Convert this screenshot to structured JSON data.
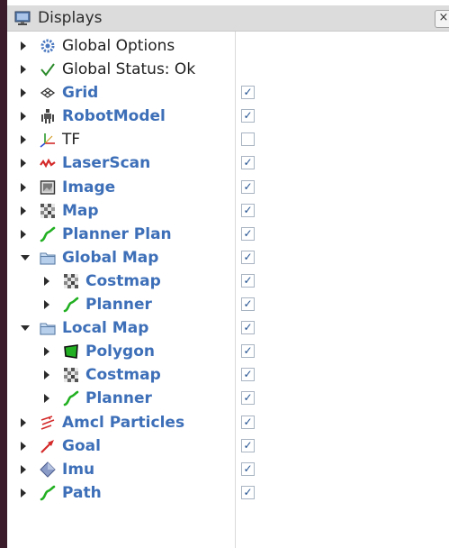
{
  "panel": {
    "title": "Displays",
    "close_label": "×"
  },
  "items": [
    {
      "id": "global-options",
      "label": "Global Options",
      "icon": "gear-icon",
      "level": 0,
      "expanded": false,
      "style": "black",
      "checkbox": null
    },
    {
      "id": "global-status",
      "label": "Global Status: Ok",
      "icon": "checkmark-icon",
      "level": 0,
      "expanded": false,
      "style": "black",
      "checkbox": null
    },
    {
      "id": "grid",
      "label": "Grid",
      "icon": "grid-icon",
      "level": 0,
      "expanded": false,
      "style": "blue",
      "checkbox": true
    },
    {
      "id": "robotmodel",
      "label": "RobotModel",
      "icon": "robot-icon",
      "level": 0,
      "expanded": false,
      "style": "blue",
      "checkbox": true
    },
    {
      "id": "tf",
      "label": "TF",
      "icon": "axes-icon",
      "level": 0,
      "expanded": false,
      "style": "black",
      "checkbox": false
    },
    {
      "id": "laserscan",
      "label": "LaserScan",
      "icon": "laser-icon",
      "level": 0,
      "expanded": false,
      "style": "blue",
      "checkbox": true
    },
    {
      "id": "image",
      "label": "Image",
      "icon": "image-icon",
      "level": 0,
      "expanded": false,
      "style": "blue",
      "checkbox": true
    },
    {
      "id": "map",
      "label": "Map",
      "icon": "map-icon",
      "level": 0,
      "expanded": false,
      "style": "blue",
      "checkbox": true
    },
    {
      "id": "planner-plan",
      "label": "Planner Plan",
      "icon": "path-icon",
      "level": 0,
      "expanded": false,
      "style": "blue",
      "checkbox": true
    },
    {
      "id": "global-map",
      "label": "Global Map",
      "icon": "folder-icon",
      "level": 0,
      "expanded": true,
      "style": "blue",
      "checkbox": true
    },
    {
      "id": "global-costmap",
      "label": "Costmap",
      "icon": "map-icon",
      "level": 1,
      "expanded": false,
      "style": "blue",
      "checkbox": true
    },
    {
      "id": "global-planner",
      "label": "Planner",
      "icon": "path-icon",
      "level": 1,
      "expanded": false,
      "style": "blue",
      "checkbox": true
    },
    {
      "id": "local-map",
      "label": "Local Map",
      "icon": "folder-icon",
      "level": 0,
      "expanded": true,
      "style": "blue",
      "checkbox": true
    },
    {
      "id": "local-polygon",
      "label": "Polygon",
      "icon": "polygon-icon",
      "level": 1,
      "expanded": false,
      "style": "blue",
      "checkbox": true
    },
    {
      "id": "local-costmap",
      "label": "Costmap",
      "icon": "map-icon",
      "level": 1,
      "expanded": false,
      "style": "blue",
      "checkbox": true
    },
    {
      "id": "local-planner",
      "label": "Planner",
      "icon": "path-icon",
      "level": 1,
      "expanded": false,
      "style": "blue",
      "checkbox": true
    },
    {
      "id": "amcl-particles",
      "label": "Amcl Particles",
      "icon": "particles-icon",
      "level": 0,
      "expanded": false,
      "style": "blue",
      "checkbox": true
    },
    {
      "id": "goal",
      "label": "Goal",
      "icon": "goal-arrow-icon",
      "level": 0,
      "expanded": false,
      "style": "blue",
      "checkbox": true
    },
    {
      "id": "imu",
      "label": "Imu",
      "icon": "imu-icon",
      "level": 0,
      "expanded": false,
      "style": "blue",
      "checkbox": true
    },
    {
      "id": "path",
      "label": "Path",
      "icon": "path-icon",
      "level": 0,
      "expanded": false,
      "style": "blue",
      "checkbox": true
    }
  ],
  "colors": {
    "label_blue": "#3d6fb8",
    "label_black": "#1f1f1f",
    "path_green": "#22b022",
    "laser_red": "#d42a2a"
  },
  "check_glyph": "✓"
}
